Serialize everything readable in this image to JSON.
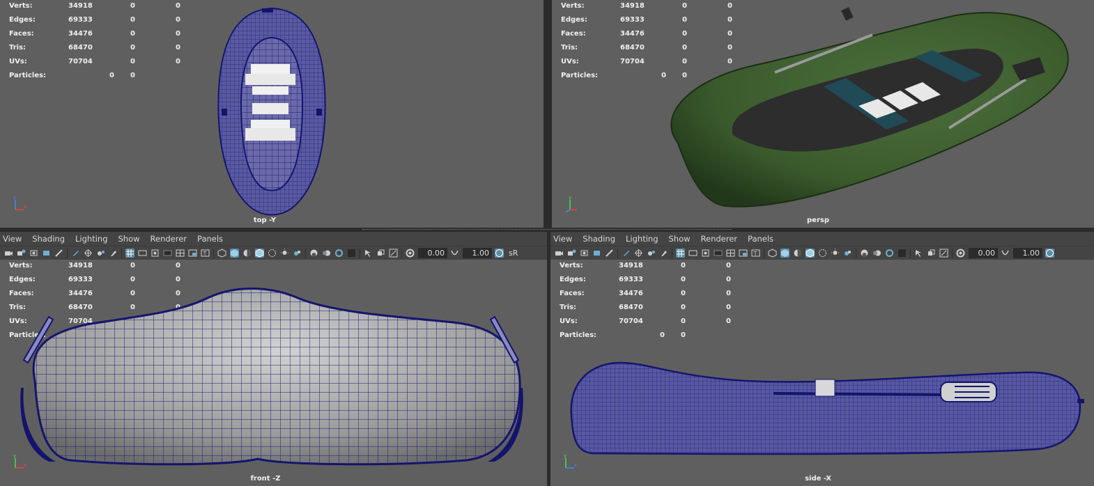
{
  "menus": [
    "View",
    "Shading",
    "Lighting",
    "Show",
    "Renderer",
    "Panels"
  ],
  "toolbar": {
    "exposure": "0.00",
    "gamma": "1.00",
    "color_space": "sR"
  },
  "hud_labels": [
    "Verts:",
    "Edges:",
    "Faces:",
    "Tris:",
    "UVs:",
    "Particles:"
  ],
  "hud_values": {
    "verts": [
      "34918",
      "0",
      "0"
    ],
    "edges": [
      "69333",
      "0",
      "0"
    ],
    "faces": [
      "34476",
      "0",
      "0"
    ],
    "tris": [
      "68470",
      "0",
      "0"
    ],
    "uvs": [
      "70704",
      "0",
      "0"
    ],
    "particles": [
      "0",
      "0"
    ]
  },
  "viewports": {
    "top": {
      "camera": "top -Y"
    },
    "persp": {
      "camera": "persp"
    },
    "front": {
      "camera": "front -Z"
    },
    "side": {
      "camera": "side -X"
    }
  },
  "colors": {
    "wire": "#1a1a7a",
    "viewport_bg": "#5f5f5f",
    "boat_green": "#3b5a2e",
    "toolbar_active": "#5d8fa6"
  }
}
